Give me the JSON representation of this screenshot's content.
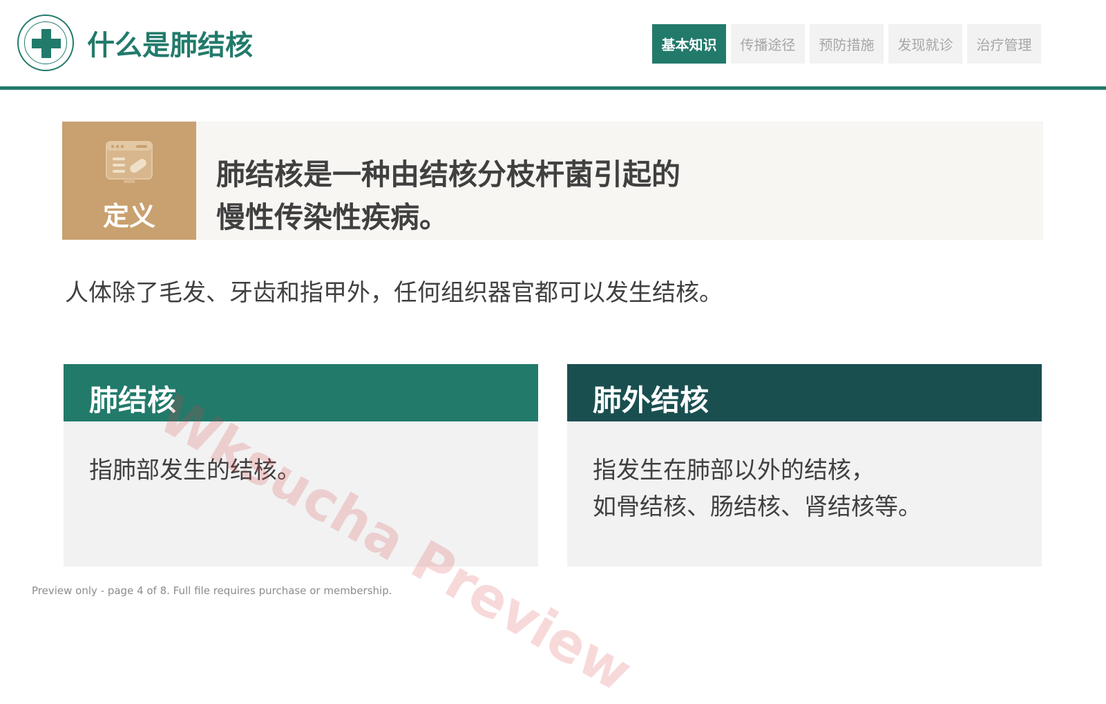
{
  "header": {
    "title": "什么是肺结核",
    "logo_icon": "medical-cross-icon",
    "accent_color": "#227a6b"
  },
  "tabs": [
    {
      "label": "基本知识",
      "active": true
    },
    {
      "label": "传播途径",
      "active": false
    },
    {
      "label": "预防措施",
      "active": false
    },
    {
      "label": "发现就诊",
      "active": false
    },
    {
      "label": "治疗管理",
      "active": false
    }
  ],
  "definition": {
    "icon": "medical-browser-icon",
    "label": "定义",
    "line1": "肺结核是一种由结核分枝杆菌引起的",
    "line2": "慢性传染性疾病。",
    "label_color": "#c9a06f"
  },
  "statement": "人体除了毛发、牙齿和指甲外，任何组织器官都可以发生结核。",
  "cards": [
    {
      "title": "肺结核",
      "body": [
        "指肺部发生的结核。"
      ],
      "color": "#227a6b"
    },
    {
      "title": "肺外结核",
      "body": [
        "指发生在肺部以外的结核，",
        "如骨结核、肠结核、肾结核等。"
      ],
      "color": "#1a4f50"
    }
  ],
  "watermark": "Wksucha Preview",
  "footer_note": "Preview only - page 4 of 8. Full file requires purchase or membership."
}
